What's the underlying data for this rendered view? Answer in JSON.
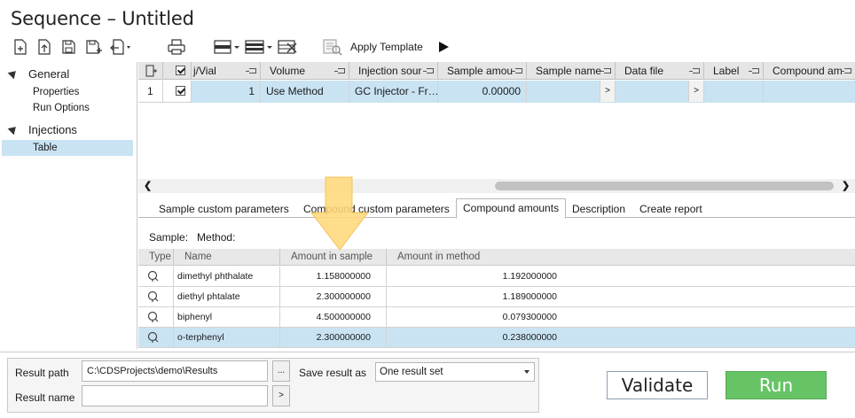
{
  "window": {
    "title": "Sequence – Untitled"
  },
  "toolbar": {
    "apply_template_label": "Apply Template",
    "icons": [
      "new-sequence-icon",
      "import-icon",
      "save-icon",
      "save-as-icon",
      "export-icon",
      "print-icon",
      "insert-row-icon",
      "insert-rows-icon",
      "delete-rows-icon",
      "apply-template-icon",
      "run-icon"
    ]
  },
  "sidebar": {
    "groups": [
      {
        "label": "General",
        "items": [
          "Properties",
          "Run Options"
        ]
      },
      {
        "label": "Injections",
        "items": [
          "Table"
        ]
      }
    ],
    "selected": "Table"
  },
  "grid": {
    "columns": [
      "j/Vial",
      "Volume",
      "Injection sour",
      "Sample amou",
      "Sample name",
      "Data file",
      "Label",
      "Compound am"
    ],
    "rows": [
      {
        "index": "1",
        "checked": true,
        "vial": "1",
        "volume": "Use Method",
        "injection_source": "GC Injector - Fr…",
        "sample_amount": "0.00000",
        "sample_name": "",
        "sample_name_browse": ">",
        "data_file": "",
        "data_file_browse": ">",
        "label": "",
        "compound_amount": ""
      }
    ]
  },
  "tabs": [
    {
      "label": "Sample custom parameters",
      "active": false
    },
    {
      "label": "Compound custom parameters",
      "active": false
    },
    {
      "label": "Compound amounts",
      "active": true
    },
    {
      "label": "Description",
      "active": false
    },
    {
      "label": "Create report",
      "active": false
    }
  ],
  "compound_panel": {
    "sample_label": "Sample:",
    "method_label": "Method:",
    "columns": [
      "Type",
      "Name",
      "Amount in sample",
      "Amount in method"
    ],
    "rows": [
      {
        "name": "dimethyl phthalate",
        "amount_in_sample": "1.158000000",
        "amount_in_method": "1.192000000",
        "selected": false
      },
      {
        "name": "diethyl phtalate",
        "amount_in_sample": "2.300000000",
        "amount_in_method": "1.189000000",
        "selected": false
      },
      {
        "name": "biphenyl",
        "amount_in_sample": "4.500000000",
        "amount_in_method": "0.079300000",
        "selected": false
      },
      {
        "name": "o-terphenyl",
        "amount_in_sample": "2.300000000",
        "amount_in_method": "0.238000000",
        "selected": true
      }
    ]
  },
  "result": {
    "path_label": "Result path",
    "path_value": "C:\\CDSProjects\\demo\\Results",
    "path_browse": "...",
    "name_label": "Result name",
    "name_value": "",
    "name_browse": ">",
    "save_as_label": "Save result as",
    "save_as_value": "One result set"
  },
  "actions": {
    "validate": "Validate",
    "run": "Run"
  },
  "colors": {
    "selection": "#c9e3f3",
    "run_button": "#66c466",
    "highlight_arrow": "#ffd87a"
  }
}
